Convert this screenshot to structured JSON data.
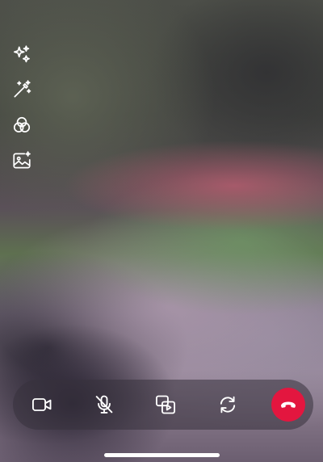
{
  "video_feed": {
    "description_state": "remote-video-blurred"
  },
  "effects": [
    {
      "id": "sparkles",
      "icon": "sparkles-icon"
    },
    {
      "id": "magic-wand",
      "icon": "magic-wand-icon"
    },
    {
      "id": "filters",
      "icon": "filters-icon"
    },
    {
      "id": "background",
      "icon": "background-image-icon"
    }
  ],
  "controls": [
    {
      "id": "camera",
      "icon": "video-camera-icon"
    },
    {
      "id": "microphone",
      "icon": "microphone-muted-icon"
    },
    {
      "id": "share",
      "icon": "screen-share-icon"
    },
    {
      "id": "flip",
      "icon": "flip-camera-icon"
    },
    {
      "id": "end-call",
      "icon": "end-call-icon"
    }
  ],
  "colors": {
    "end_call": "#e3163f",
    "icon": "#ffffff",
    "control_bar": "rgba(55,50,60,0.55)"
  }
}
